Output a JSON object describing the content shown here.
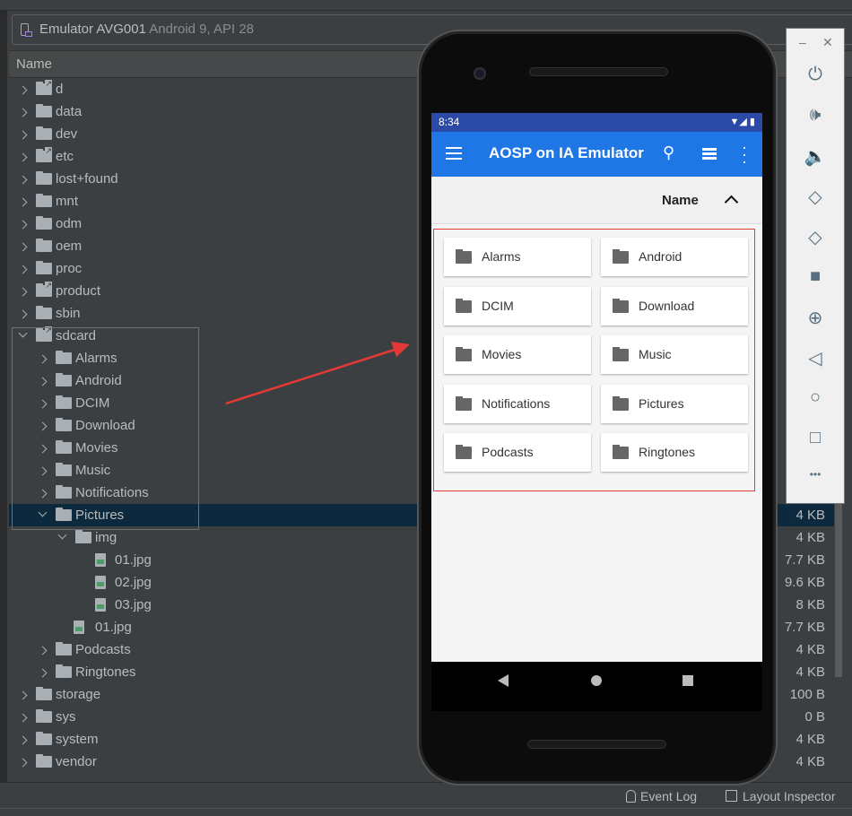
{
  "device_selector": {
    "device": "Emulator AVG001",
    "details": "Android 9, API 28"
  },
  "table": {
    "name_header": "Name"
  },
  "tree": [
    {
      "name": "d",
      "level": 0,
      "type": "link",
      "arrow": "right",
      "size": ""
    },
    {
      "name": "data",
      "level": 0,
      "type": "folder",
      "arrow": "right",
      "size": ""
    },
    {
      "name": "dev",
      "level": 0,
      "type": "folder",
      "arrow": "right",
      "size": ""
    },
    {
      "name": "etc",
      "level": 0,
      "type": "link",
      "arrow": "right",
      "size": ""
    },
    {
      "name": "lost+found",
      "level": 0,
      "type": "folder",
      "arrow": "right",
      "size": ""
    },
    {
      "name": "mnt",
      "level": 0,
      "type": "folder",
      "arrow": "right",
      "size": ""
    },
    {
      "name": "odm",
      "level": 0,
      "type": "folder",
      "arrow": "right",
      "size": ""
    },
    {
      "name": "oem",
      "level": 0,
      "type": "folder",
      "arrow": "right",
      "size": ""
    },
    {
      "name": "proc",
      "level": 0,
      "type": "folder",
      "arrow": "right",
      "size": ""
    },
    {
      "name": "product",
      "level": 0,
      "type": "link",
      "arrow": "right",
      "size": ""
    },
    {
      "name": "sbin",
      "level": 0,
      "type": "folder",
      "arrow": "right",
      "size": ""
    },
    {
      "name": "sdcard",
      "level": 0,
      "type": "link",
      "arrow": "down",
      "size": ""
    },
    {
      "name": "Alarms",
      "level": 1,
      "type": "folder",
      "arrow": "right",
      "size": ""
    },
    {
      "name": "Android",
      "level": 1,
      "type": "folder",
      "arrow": "right",
      "size": ""
    },
    {
      "name": "DCIM",
      "level": 1,
      "type": "folder",
      "arrow": "right",
      "size": ""
    },
    {
      "name": "Download",
      "level": 1,
      "type": "folder",
      "arrow": "right",
      "size": ""
    },
    {
      "name": "Movies",
      "level": 1,
      "type": "folder",
      "arrow": "right",
      "size": ""
    },
    {
      "name": "Music",
      "level": 1,
      "type": "folder",
      "arrow": "right",
      "size": ""
    },
    {
      "name": "Notifications",
      "level": 1,
      "type": "folder",
      "arrow": "right",
      "size": ""
    },
    {
      "name": "Pictures",
      "level": 1,
      "type": "folder",
      "arrow": "down",
      "size": "4 KB",
      "selected": true
    },
    {
      "name": "img",
      "level": 2,
      "type": "folder",
      "arrow": "down",
      "size": "4 KB"
    },
    {
      "name": "01.jpg",
      "level": 3,
      "type": "file",
      "arrow": "",
      "size": "7.7 KB"
    },
    {
      "name": "02.jpg",
      "level": 3,
      "type": "file",
      "arrow": "",
      "size": "9.6 KB"
    },
    {
      "name": "03.jpg",
      "level": 3,
      "type": "file",
      "arrow": "",
      "size": "8 KB"
    },
    {
      "name": "01.jpg",
      "level": 2,
      "type": "file",
      "arrow": "",
      "size": "7.7 KB"
    },
    {
      "name": "Podcasts",
      "level": 1,
      "type": "folder",
      "arrow": "right",
      "size": "4 KB"
    },
    {
      "name": "Ringtones",
      "level": 1,
      "type": "folder",
      "arrow": "right",
      "size": "4 KB"
    },
    {
      "name": "storage",
      "level": 0,
      "type": "folder",
      "arrow": "right",
      "size": "100 B"
    },
    {
      "name": "sys",
      "level": 0,
      "type": "folder",
      "arrow": "right",
      "size": "0 B"
    },
    {
      "name": "system",
      "level": 0,
      "type": "folder",
      "arrow": "right",
      "size": "4 KB"
    },
    {
      "name": "vendor",
      "level": 0,
      "type": "folder",
      "arrow": "right",
      "size": "4 KB"
    }
  ],
  "statusbar": {
    "event_log": "Event Log",
    "layout_inspector": "Layout Inspector"
  },
  "phone": {
    "time": "8:34",
    "app_title": "AOSP on IA Emulator",
    "sort_label": "Name",
    "folders": [
      "Alarms",
      "Android",
      "DCIM",
      "Download",
      "Movies",
      "Music",
      "Notifications",
      "Pictures",
      "Podcasts",
      "Ringtones"
    ],
    "colors": {
      "status_bar": "#2b4aa8",
      "app_bar": "#1f77e6",
      "highlight": "#e53935"
    }
  },
  "emulator_toolbar": {
    "icons": [
      "power-icon",
      "volume-up-icon",
      "volume-down-icon",
      "rotate-left-icon",
      "rotate-right-icon",
      "camera-icon",
      "zoom-icon",
      "back-icon",
      "home-icon",
      "overview-icon",
      "more-icon"
    ]
  },
  "annotation": {
    "arrow_color": "#e53935"
  }
}
